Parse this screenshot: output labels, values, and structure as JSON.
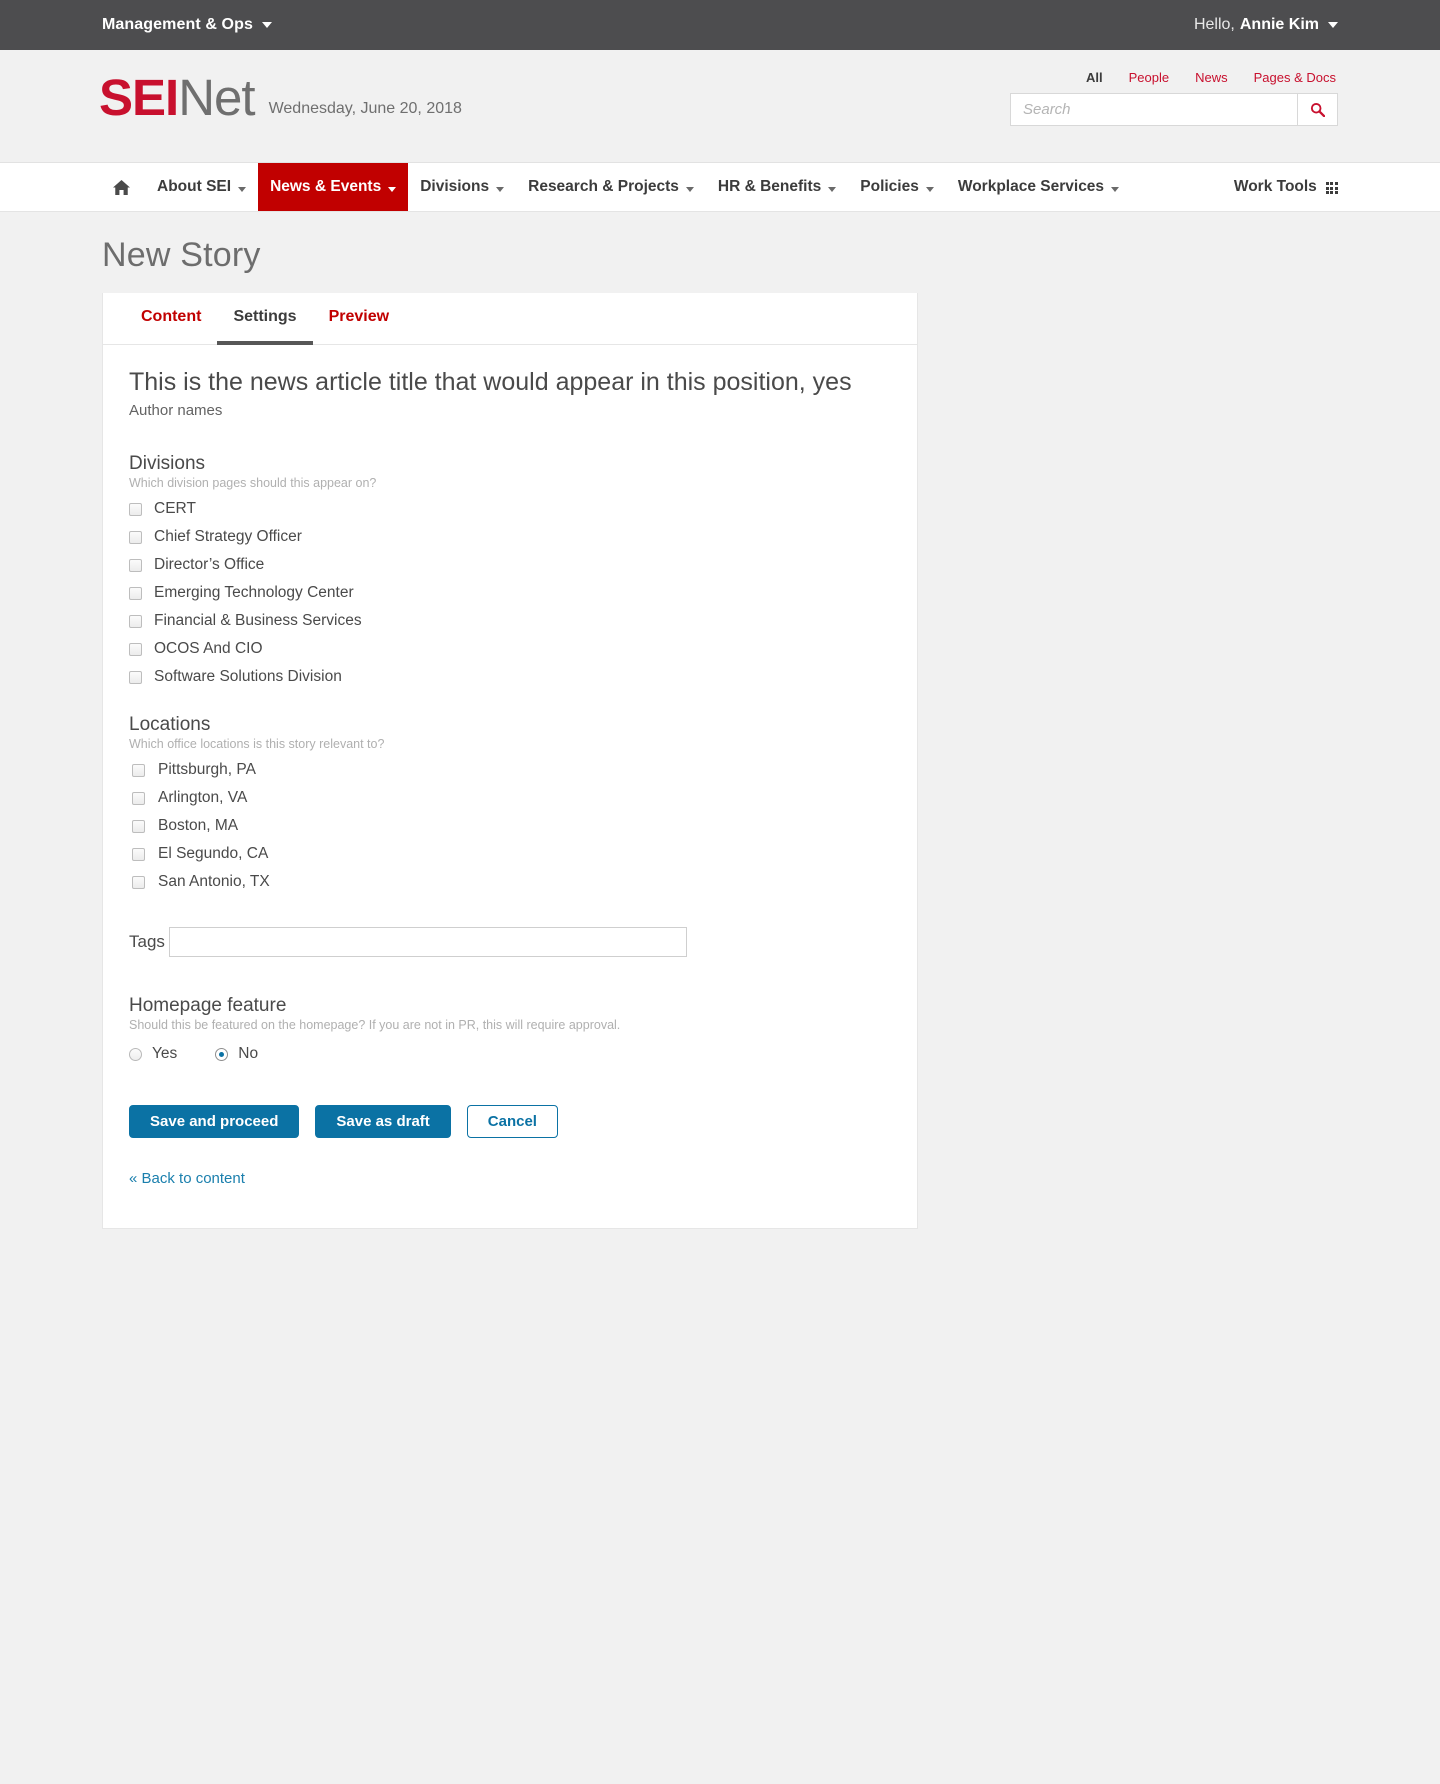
{
  "utility_bar": {
    "org_label": "Management & Ops",
    "org_caret_icon": "caret-down-icon",
    "greeting": "Hello,",
    "user_name": "Annie Kim",
    "user_caret_icon": "caret-down-icon"
  },
  "masthead": {
    "logo_primary": "SEI",
    "logo_secondary": "Net",
    "date": "Wednesday, June 20, 2018",
    "brand_color": "#c8102e",
    "search": {
      "tabs": [
        {
          "label": "All",
          "active": true
        },
        {
          "label": "People",
          "active": false
        },
        {
          "label": "News",
          "active": false
        },
        {
          "label": "Pages & Docs",
          "active": false
        }
      ],
      "placeholder": "Search",
      "value": "",
      "button_icon": "search-icon"
    }
  },
  "mainnav": {
    "home_icon": "home-icon",
    "items": [
      {
        "label": "About SEI",
        "has_caret": true,
        "active": false
      },
      {
        "label": "News & Events",
        "has_caret": true,
        "active": true
      },
      {
        "label": "Divisions",
        "has_caret": true,
        "active": false
      },
      {
        "label": "Research & Projects",
        "has_caret": true,
        "active": false
      },
      {
        "label": "HR & Benefits",
        "has_caret": true,
        "active": false
      },
      {
        "label": "Policies",
        "has_caret": true,
        "active": false
      },
      {
        "label": "Workplace Services",
        "has_caret": true,
        "active": false
      }
    ],
    "work_tools_label": "Work Tools",
    "work_tools_icon": "grid-apps-icon",
    "active_color": "#c10000"
  },
  "page": {
    "title": "New Story"
  },
  "editor": {
    "tabs": [
      {
        "label": "Content",
        "active": false
      },
      {
        "label": "Settings",
        "active": true
      },
      {
        "label": "Preview",
        "active": false
      }
    ],
    "story_title": "This is the news article title that would appear in this position, yes",
    "story_authors": "Author names",
    "divisions": {
      "label": "Divisions",
      "hint": "Which division pages should this appear on?",
      "options": [
        {
          "label": "CERT",
          "checked": false
        },
        {
          "label": "Chief Strategy Officer",
          "checked": false
        },
        {
          "label": "Director’s Office",
          "checked": false
        },
        {
          "label": "Emerging Technology Center",
          "checked": false
        },
        {
          "label": "Financial & Business Services",
          "checked": false
        },
        {
          "label": "OCOS And CIO",
          "checked": false
        },
        {
          "label": "Software Solutions Division",
          "checked": false
        }
      ]
    },
    "locations": {
      "label": "Locations",
      "hint": "Which office locations is this story relevant to?",
      "options": [
        {
          "label": "Pittsburgh, PA",
          "checked": false
        },
        {
          "label": "Arlington, VA",
          "checked": false
        },
        {
          "label": "Boston, MA",
          "checked": false
        },
        {
          "label": "El Segundo, CA",
          "checked": false
        },
        {
          "label": "San Antonio, TX",
          "checked": false
        }
      ]
    },
    "tags": {
      "label": "Tags",
      "value": "",
      "placeholder": ""
    },
    "homepage_feature": {
      "label": "Homepage feature",
      "hint": "Should this be featured on the homepage? If you are not in PR, this will require approval.",
      "options": [
        {
          "label": "Yes",
          "selected": false
        },
        {
          "label": "No",
          "selected": true
        }
      ]
    },
    "actions": {
      "save_and_proceed": "Save and proceed",
      "save_as_draft": "Save as draft",
      "cancel": "Cancel",
      "back_link": "« Back to content",
      "primary_color": "#0b72a4"
    }
  }
}
